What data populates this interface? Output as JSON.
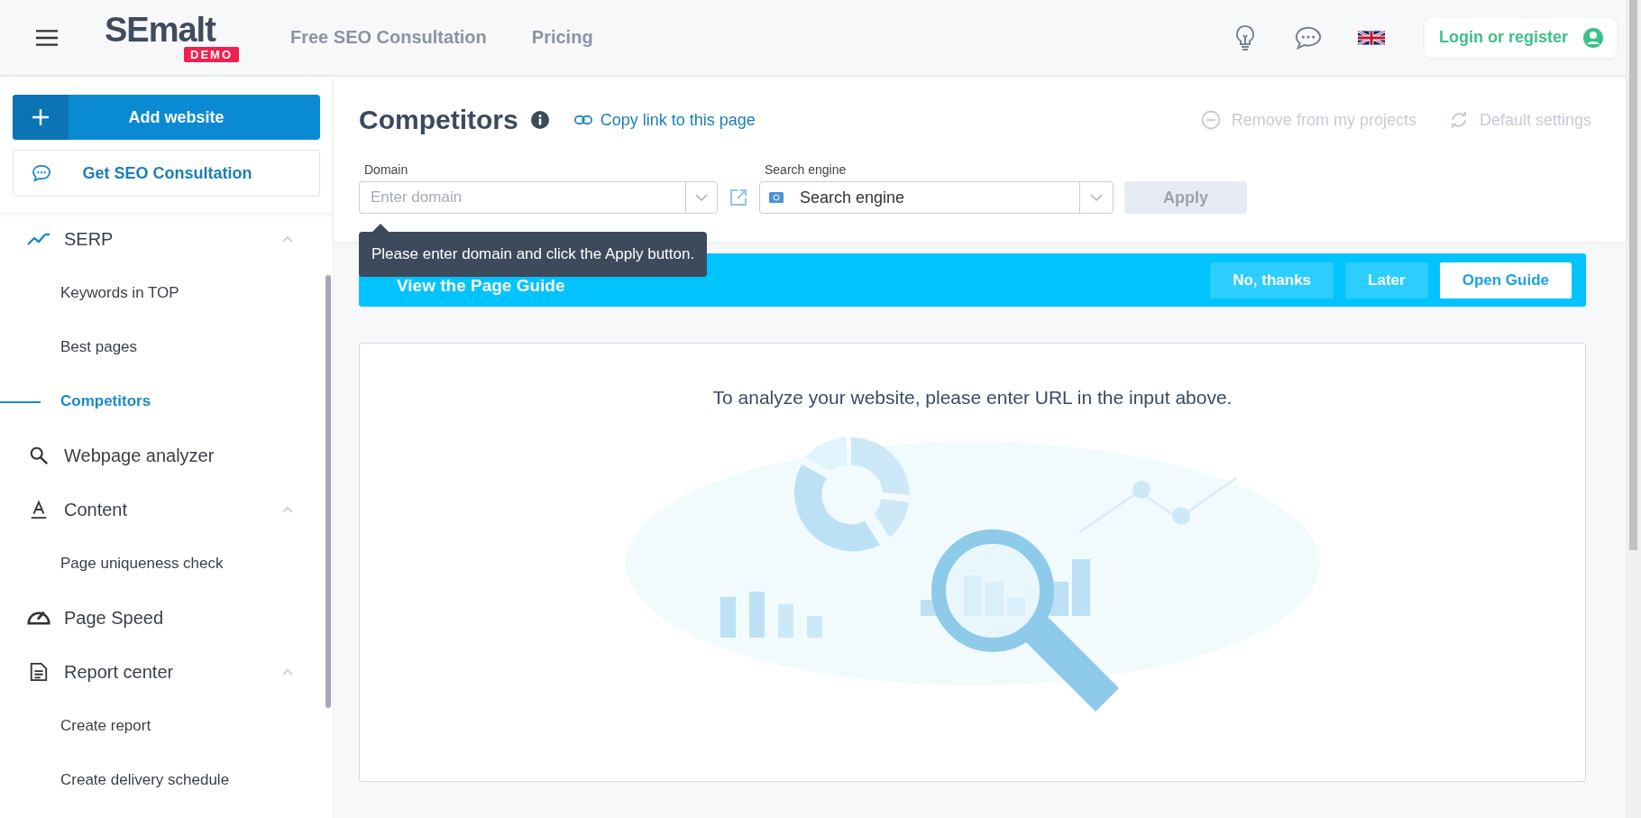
{
  "header": {
    "brand": "SEmalt",
    "brand_badge": "DEMO",
    "nav": [
      "Free SEO Consultation",
      "Pricing"
    ],
    "login": "Login or register"
  },
  "sidebar": {
    "add_button": "Add website",
    "consult_button": "Get SEO Consultation",
    "items": [
      {
        "label": "SERP",
        "selected": false,
        "expanded": true,
        "children": [
          {
            "label": "Keywords in TOP",
            "selected": false
          },
          {
            "label": "Best pages",
            "selected": false
          },
          {
            "label": "Competitors",
            "selected": true
          }
        ]
      },
      {
        "label": "Webpage analyzer",
        "selected": false
      },
      {
        "label": "Content",
        "selected": false,
        "expanded": true,
        "children": [
          {
            "label": "Page uniqueness check",
            "selected": false
          }
        ]
      },
      {
        "label": "Page Speed",
        "selected": false
      },
      {
        "label": "Report center",
        "selected": false,
        "expanded": true,
        "children": [
          {
            "label": "Create report",
            "selected": false
          },
          {
            "label": "Create delivery schedule",
            "selected": false
          }
        ]
      }
    ]
  },
  "page": {
    "title": "Competitors",
    "copy_link": "Copy link to this page",
    "actions": [
      {
        "label": "Remove from my projects",
        "disabled": true
      },
      {
        "label": "Default settings",
        "disabled": true
      }
    ],
    "domain": {
      "label": "Domain",
      "placeholder": "Enter domain"
    },
    "engine": {
      "label": "Search engine",
      "value": "Search engine"
    },
    "apply": {
      "label": "Apply",
      "disabled": true
    },
    "tooltip": "Please enter domain and click the Apply button.",
    "guide": {
      "title": "View the Page Guide",
      "buttons": [
        {
          "label": "No, thanks",
          "kind": "secondary"
        },
        {
          "label": "Later",
          "kind": "secondary"
        },
        {
          "label": "Open Guide",
          "kind": "primary"
        }
      ]
    },
    "empty_message": "To analyze your website, please enter URL in the input above."
  }
}
